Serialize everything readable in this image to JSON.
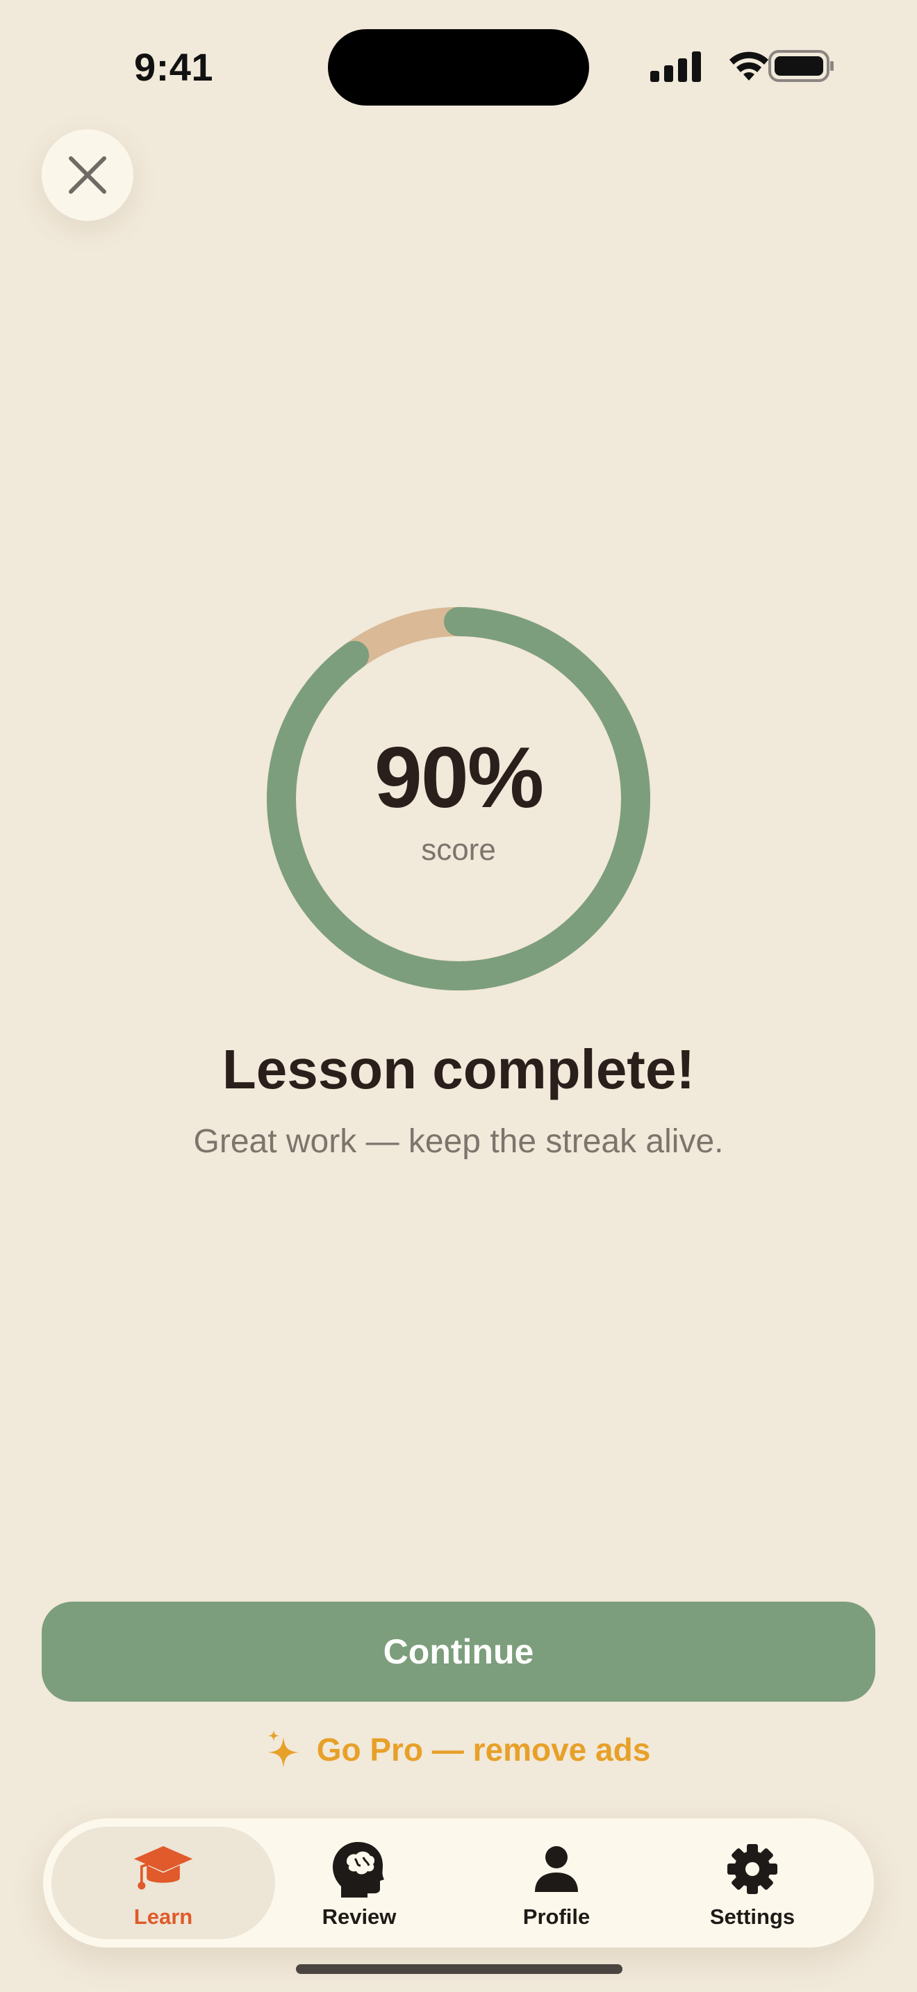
{
  "status_bar": {
    "time": "9:41"
  },
  "score": {
    "value_text": "90%",
    "percent": 90,
    "label": "score"
  },
  "result": {
    "title": "Lesson complete!",
    "subtitle": "Great work — keep the streak alive."
  },
  "actions": {
    "continue_label": "Continue",
    "gopro_label": "Go Pro — remove ads"
  },
  "tabbar": {
    "active": "learn",
    "items": [
      {
        "id": "learn",
        "label": "Learn",
        "icon": "graduation-cap-icon"
      },
      {
        "id": "review",
        "label": "Review",
        "icon": "brain-head-icon"
      },
      {
        "id": "profile",
        "label": "Profile",
        "icon": "person-icon"
      },
      {
        "id": "settings",
        "label": "Settings",
        "icon": "gear-icon"
      }
    ]
  },
  "colors": {
    "background": "#F1E9DA",
    "ring_progress": "#7C9E7C",
    "ring_track": "#D9B996",
    "primary_button": "#7C9E7C",
    "accent_gold": "#E7A028",
    "active_tab": "#E05A2B",
    "text_dark": "#2B1F1B",
    "text_muted": "#7D746C"
  }
}
